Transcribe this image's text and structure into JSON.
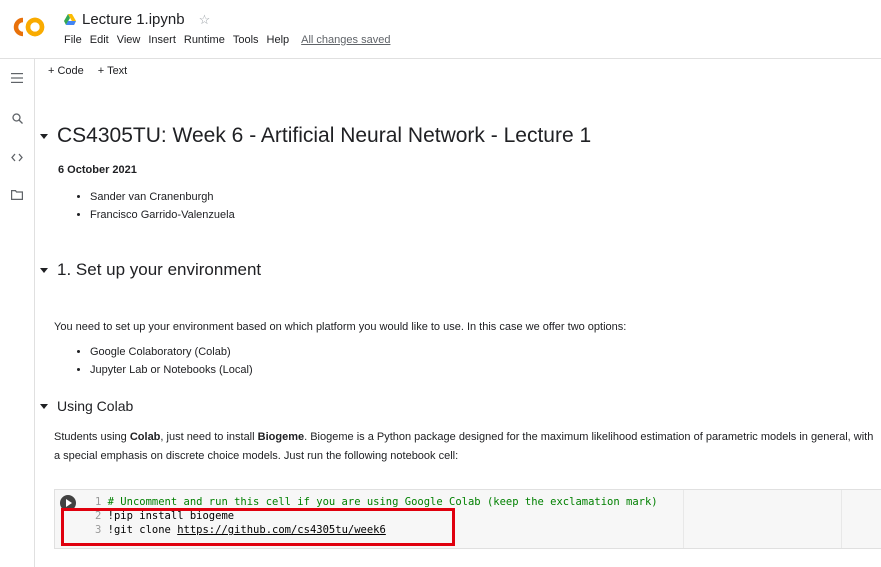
{
  "header": {
    "logo_text": "CO",
    "title": "Lecture 1.ipynb",
    "menu": [
      "File",
      "Edit",
      "View",
      "Insert",
      "Runtime",
      "Tools",
      "Help"
    ],
    "save_status": "All changes saved"
  },
  "toolbar": {
    "code": "+ Code",
    "text": "+ Text"
  },
  "sidebar": {
    "icons": [
      "toc-icon",
      "search-icon",
      "code-snippets-icon",
      "folder-icon"
    ]
  },
  "notebook": {
    "heading1": "CS4305TU: Week 6 - Artificial Neural Network - Lecture 1",
    "date": "6 October 2021",
    "authors": [
      "Sander van Cranenburgh",
      "Francisco Garrido-Valenzuela"
    ],
    "heading2": "1. Set up your environment",
    "intro": "You need to set up your environment based on which platform you would like to use. In this case we offer two options:",
    "options": [
      "Google Colaboratory (Colab)",
      "Jupyter Lab or Notebooks (Local)"
    ],
    "heading3": "Using Colab",
    "colab_text": {
      "p1": "Students using ",
      "b1": "Colab",
      "p2": ", just need to install ",
      "b2": "Biogeme",
      "p3": ". Biogeme is a Python package designed for the maximum likelihood estimation of parametric models in general, with a special emphasis on discrete choice models. Just run the following notebook cell:"
    },
    "code": {
      "line1_num": "1",
      "line1": "# Uncomment and run this cell if you are using Google Colab (keep the exclamation mark)",
      "line2_num": "2",
      "line2": "!pip install biogeme",
      "line3_num": "3",
      "line3_prefix": "!git clone ",
      "line3_url": "https://github.com/cs4305tu/week6"
    }
  },
  "colors": {
    "logo_orange": "#f9ab00",
    "highlight_red": "#e0000e",
    "comment_green": "#008000"
  }
}
